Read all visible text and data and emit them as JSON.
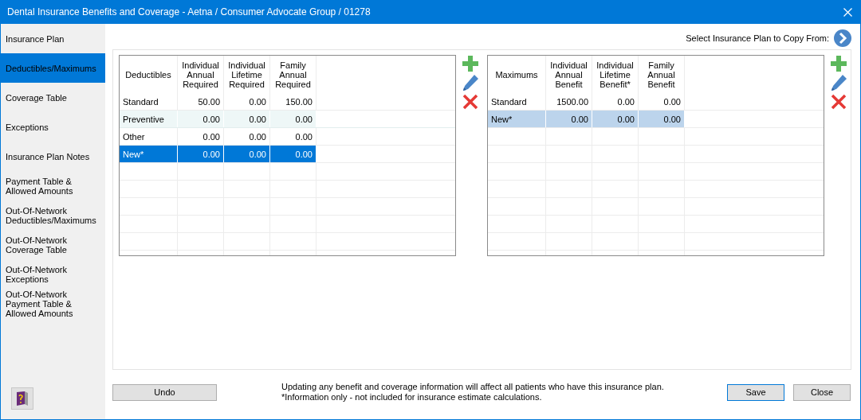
{
  "window": {
    "title": "Dental Insurance Benefits and Coverage - Aetna / Consumer Advocate Group / 01278"
  },
  "sidebar": {
    "items": [
      {
        "label": "Insurance Plan",
        "selected": false
      },
      {
        "label": "Deductibles/Maximums",
        "selected": true
      },
      {
        "label": "Coverage Table",
        "selected": false
      },
      {
        "label": "Exceptions",
        "selected": false
      },
      {
        "label": "Insurance Plan Notes",
        "selected": false
      },
      {
        "label": "Payment Table & Allowed Amounts",
        "selected": false
      },
      {
        "label": "Out-Of-Network Deductibles/Maximums",
        "selected": false
      },
      {
        "label": "Out-Of-Network Coverage Table",
        "selected": false
      },
      {
        "label": "Out-Of-Network Exceptions",
        "selected": false
      },
      {
        "label": "Out-Of-Network Payment Table & Allowed Amounts",
        "selected": false
      }
    ]
  },
  "copy_from": {
    "label": "Select Insurance Plan to Copy From:"
  },
  "tables": [
    {
      "focused": true,
      "columns": [
        "Deductibles",
        "Individual Annual Required",
        "Individual Lifetime Required",
        "Family Annual Required"
      ],
      "rows": [
        {
          "cells": [
            "Standard",
            "50.00",
            "0.00",
            "150.00"
          ],
          "selected": false,
          "highlighted": false
        },
        {
          "cells": [
            "Preventive",
            "0.00",
            "0.00",
            "0.00"
          ],
          "selected": false,
          "highlighted": true
        },
        {
          "cells": [
            "Other",
            "0.00",
            "0.00",
            "0.00"
          ],
          "selected": false,
          "highlighted": false
        },
        {
          "cells": [
            "New*",
            "0.00",
            "0.00",
            "0.00"
          ],
          "selected": true,
          "highlighted": false
        }
      ]
    },
    {
      "focused": false,
      "columns": [
        "Maximums",
        "Individual Annual Benefit",
        "Individual Lifetime Benefit*",
        "Family Annual Benefit"
      ],
      "rows": [
        {
          "cells": [
            "Standard",
            "1500.00",
            "0.00",
            "0.00"
          ],
          "selected": false,
          "highlighted": false
        },
        {
          "cells": [
            "New*",
            "0.00",
            "0.00",
            "0.00"
          ],
          "selected": true,
          "highlighted": false
        }
      ]
    }
  ],
  "footer": {
    "undo": "Undo",
    "notes": [
      "Updating any benefit and coverage information will affect all patients who have this insurance plan.",
      "*Information only - not included for insurance estimate calculations."
    ],
    "buttons": [
      {
        "label": "Save",
        "default": true
      },
      {
        "label": "Close",
        "default": false
      }
    ]
  }
}
